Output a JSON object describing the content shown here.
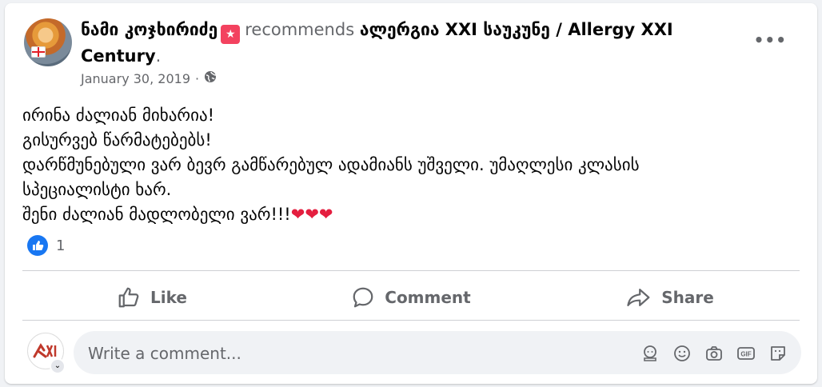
{
  "post": {
    "author": "ნამი კოჯხირიძე",
    "recommends_text": "recommends",
    "page_name_line1": "ალერგია XXI საუკუნე / Allergy XXI",
    "page_name_line2": "Century",
    "date": "January 30, 2019",
    "separator": "·",
    "audience_icon": "globe-icon",
    "more_icon": "more-options-icon",
    "more_glyph": "•••",
    "recommend_icon": "recommend-badge-icon",
    "body_lines": [
      "ირინა ძალიან მიხარია!",
      "გისურვებ წარმატებებს!",
      "დარწმუნებული ვარ ბევრ გამწარებულ ადამიანს უშველი. უმაღლესი კლასის",
      "სპეციალისტი ხარ.",
      "შენი ძალიან მადლობელი ვარ!!!"
    ],
    "hearts": "❤❤❤"
  },
  "reactions": {
    "icon": "like-reaction-icon",
    "count": "1"
  },
  "actions": {
    "like_label": "Like",
    "comment_label": "Comment",
    "share_label": "Share"
  },
  "comment": {
    "placeholder": "Write a comment...",
    "icons": [
      "avatar-sticker-icon",
      "emoji-icon",
      "camera-icon",
      "gif-icon",
      "sticker-icon"
    ]
  },
  "colors": {
    "accent": "#1877f2",
    "heart": "#e41e3f",
    "recommend_badge": "#f3425f",
    "secondary_text": "#65676b"
  }
}
